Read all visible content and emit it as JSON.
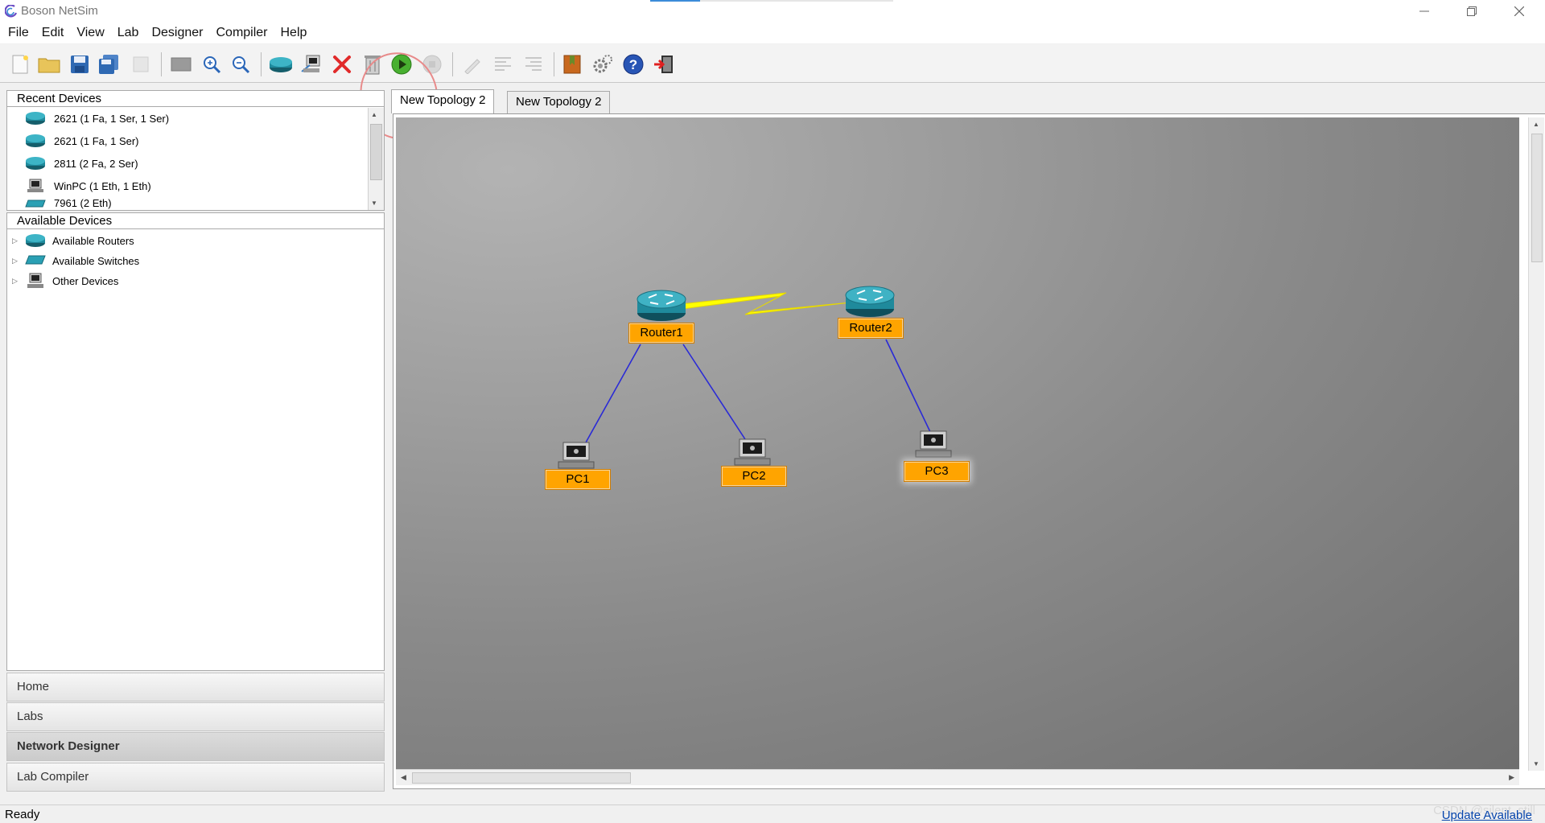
{
  "window": {
    "title": "Boson NetSim"
  },
  "menu": [
    "File",
    "Edit",
    "View",
    "Lab",
    "Designer",
    "Compiler",
    "Help"
  ],
  "toolbar": {
    "icons": [
      "new-icon",
      "open-folder-icon",
      "save-icon",
      "save-all-icon",
      "properties-icon",
      "screen-icon",
      "zoom-in-icon",
      "zoom-out-icon",
      "add-router-icon",
      "add-pc-icon",
      "delete-icon",
      "trash-icon",
      "play-icon",
      "stop-icon",
      "pencil-icon",
      "align-icon",
      "align-right-icon",
      "book-icon",
      "settings-icon",
      "help-icon",
      "exit-icon"
    ]
  },
  "recent_devices": {
    "title": "Recent Devices",
    "items": [
      {
        "label": "2621 (1 Fa, 1 Ser, 1 Ser)",
        "icon": "router-icon"
      },
      {
        "label": "2621 (1 Fa, 1 Ser)",
        "icon": "router-icon"
      },
      {
        "label": "2811 (2 Fa, 2 Ser)",
        "icon": "router-icon"
      },
      {
        "label": "WinPC (1 Eth, 1 Eth)",
        "icon": "pc-icon"
      },
      {
        "label": "7961 (2 Eth)",
        "icon": "switch-icon"
      }
    ]
  },
  "available_devices": {
    "title": "Available Devices",
    "items": [
      {
        "label": "Available Routers",
        "icon": "router-icon"
      },
      {
        "label": "Available Switches",
        "icon": "switch-icon"
      },
      {
        "label": "Other Devices",
        "icon": "pc-icon"
      }
    ]
  },
  "nav": {
    "home": "Home",
    "labs": "Labs",
    "network_designer": "Network Designer",
    "lab_compiler": "Lab Compiler"
  },
  "tabs": [
    "New Topology 2",
    "New Topology 2"
  ],
  "topology": {
    "nodes": {
      "router1": "Router1",
      "router2": "Router2",
      "pc1": "PC1",
      "pc2": "PC2",
      "pc3": "PC3"
    }
  },
  "status": {
    "text": "Ready",
    "update": "Update Available",
    "watermark": "CSDN @silent_still"
  },
  "colors": {
    "label_bg": "#ffa400",
    "link_ethernet": "#2a2ad6",
    "link_serial": "#ffff00",
    "router": "#1f8a9c"
  }
}
